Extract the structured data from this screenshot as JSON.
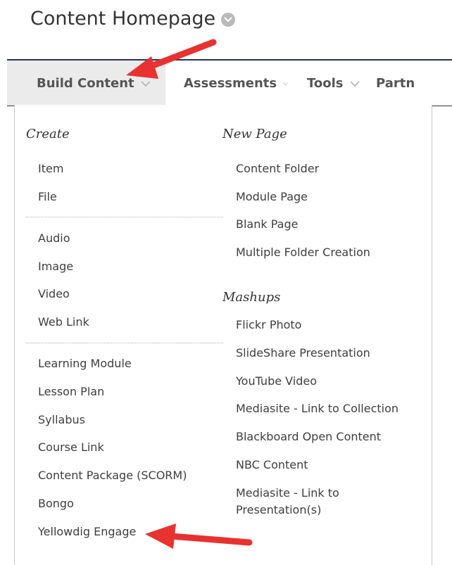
{
  "page": {
    "title": "Content Homepage"
  },
  "toolbar": {
    "items": [
      {
        "label": "Build Content",
        "active": true
      },
      {
        "label": "Assessments"
      },
      {
        "label": "Tools"
      },
      {
        "label": "Partn"
      }
    ]
  },
  "dropdown": {
    "create": {
      "heading": "Create",
      "group1": [
        "Item",
        "File"
      ],
      "group2": [
        "Audio",
        "Image",
        "Video",
        "Web Link"
      ],
      "group3": [
        "Learning Module",
        "Lesson Plan",
        "Syllabus",
        "Course Link",
        "Content Package (SCORM)",
        "Bongo",
        "Yellowdig Engage"
      ]
    },
    "new_page": {
      "heading": "New Page",
      "items": [
        "Content Folder",
        "Module Page",
        "Blank Page",
        "Multiple Folder Creation"
      ]
    },
    "mashups": {
      "heading": "Mashups",
      "items": [
        "Flickr Photo",
        "SlideShare Presentation",
        "YouTube Video",
        "Mediasite - Link to Collection",
        "Blackboard Open Content",
        "NBC Content",
        "Mediasite - Link to",
        "Presentation(s)"
      ]
    }
  },
  "colors": {
    "accent_arrow": "#e8322f",
    "toolbar_border": "#233456",
    "active_tab_bg": "#ebebeb"
  },
  "icons": {
    "title_menu": "chevron-down-circle-icon",
    "tab_menu": "chevron-down-icon",
    "annotation": "red-arrow-icon"
  }
}
